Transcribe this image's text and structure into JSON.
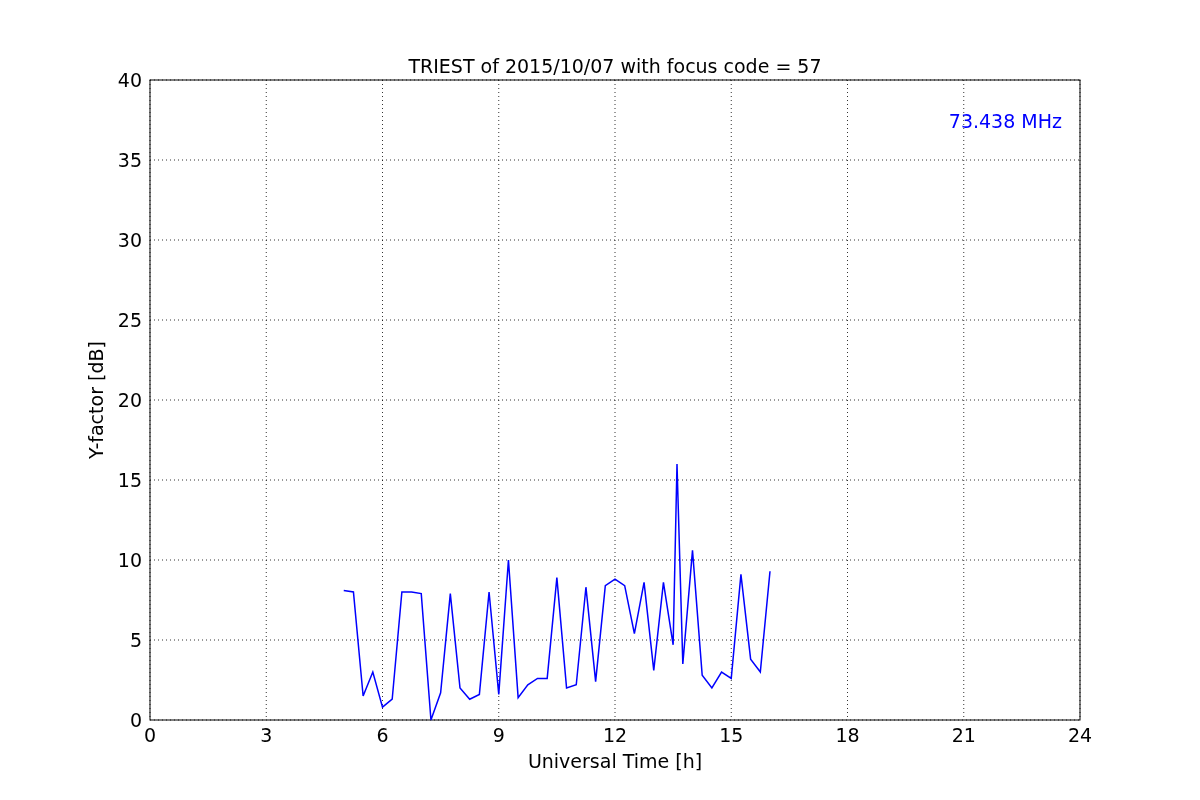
{
  "figure": {
    "chart_data": {
      "type": "line",
      "title": "TRIEST of 2015/10/07 with focus code = 57",
      "xlabel": "Universal Time [h]",
      "ylabel": "Y-factor [dB]",
      "x": [
        5.0,
        5.25,
        5.5,
        5.75,
        6.0,
        6.25,
        6.5,
        6.75,
        7.0,
        7.25,
        7.5,
        7.75,
        8.0,
        8.25,
        8.5,
        8.75,
        9.0,
        9.25,
        9.5,
        9.75,
        10.0,
        10.25,
        10.5,
        10.75,
        11.0,
        11.25,
        11.5,
        11.75,
        12.0,
        12.25,
        12.5,
        12.75,
        13.0,
        13.25,
        13.5,
        13.6,
        13.75,
        14.0,
        14.25,
        14.5,
        14.75,
        15.0,
        15.25,
        15.5,
        15.75,
        16.0
      ],
      "series": [
        {
          "name": "73.438 MHz",
          "color": "#0000ff",
          "values": [
            8.1,
            8.0,
            1.5,
            3.0,
            0.8,
            1.3,
            8.0,
            8.0,
            7.9,
            0.0,
            1.7,
            7.9,
            2.0,
            1.3,
            1.6,
            8.0,
            1.6,
            10.0,
            1.4,
            2.2,
            2.6,
            2.6,
            8.9,
            2.0,
            2.2,
            8.3,
            2.4,
            8.4,
            8.8,
            8.4,
            5.4,
            8.6,
            3.1,
            8.6,
            4.7,
            16.0,
            3.5,
            10.6,
            2.8,
            2.0,
            3.0,
            2.6,
            9.1,
            3.8,
            3.0,
            9.3
          ]
        }
      ],
      "xlim": [
        0,
        24
      ],
      "ylim": [
        0,
        40
      ],
      "xticks": [
        0,
        3,
        6,
        9,
        12,
        15,
        18,
        21,
        24
      ],
      "yticks": [
        0,
        5,
        10,
        15,
        20,
        25,
        30,
        35,
        40
      ],
      "grid": true
    }
  }
}
